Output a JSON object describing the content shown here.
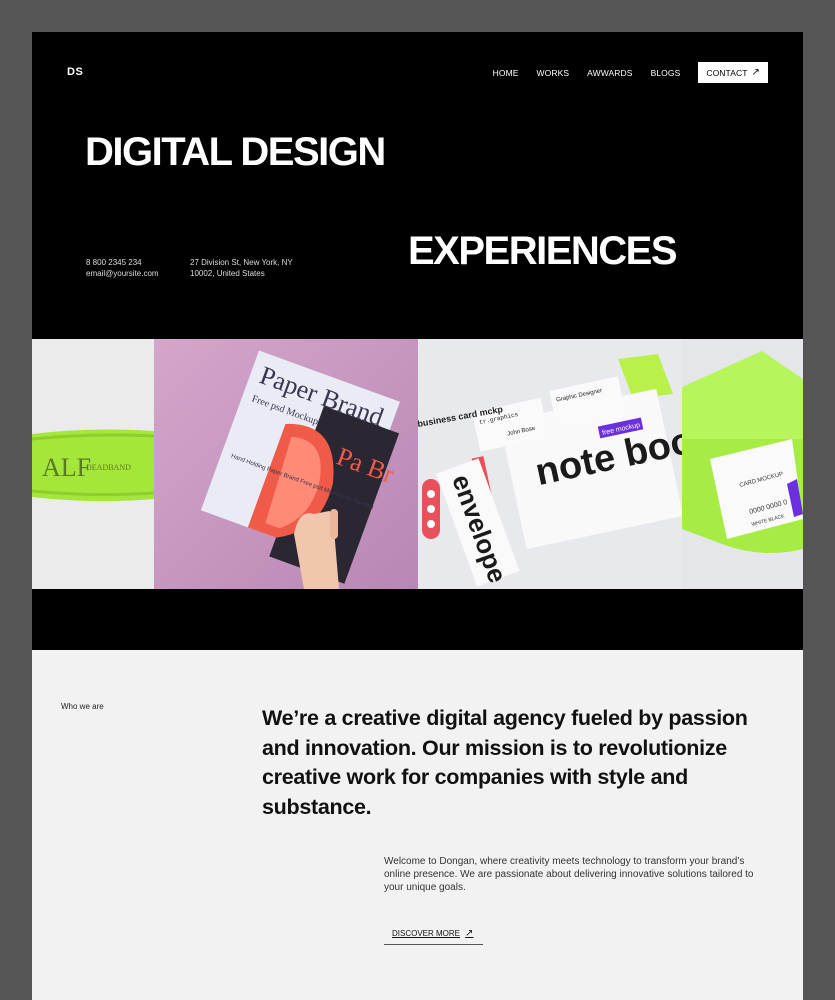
{
  "brand": {
    "logo": "DS"
  },
  "nav": {
    "items": [
      "HOME",
      "WORKS",
      "AWWARDS",
      "BLOGS"
    ],
    "contact_label": "CONTACT",
    "contact_arrow": "↗"
  },
  "hero": {
    "title_line1": "DIGITAL DESIGN",
    "title_line2": "EXPERIENCES",
    "phone": "8 800 2345 234",
    "email": "email@yoursite.com",
    "address_line1": "27 Division St, New York, NY",
    "address_line2": "10002, United States"
  },
  "gallery": {
    "tile1": {
      "text": "DEADBAND",
      "partial": "ALF"
    },
    "tile2": {
      "title": "Paper Brand",
      "subtitle": "Free psd Mockup",
      "caption": "Hand Holding Paper Brand Free psd Mockup by Pixeden",
      "back": "Pa Br"
    },
    "tile3": {
      "notebook": "note book",
      "envelope": "envelope",
      "card": "business card mckp",
      "tag": "free mockup",
      "brand": "tr.graphics",
      "role": "Graphic Designer",
      "name": "John Bose"
    },
    "tile4": {
      "label": "CARD MOCKUP",
      "number": "0000 0000 0",
      "text": "WHITE BLACK"
    }
  },
  "about": {
    "label": "Who we are",
    "mission": "We’re a creative digital agency fueled by passion and innovation. Our mission is to revolutionize creative work for companies with style and substance.",
    "welcome": "Welcome to Dongan, where creativity meets technology to transform your brand’s online presence. We are passionate about delivering innovative solutions tailored to your unique goals.",
    "cta_label": "DISCOVER MORE",
    "cta_arrow": "↗"
  },
  "colors": {
    "hero_bg": "#000000",
    "page_bg": "#f2f2f2",
    "accent_green": "#b8f558",
    "accent_purple": "#6b2fe0"
  }
}
